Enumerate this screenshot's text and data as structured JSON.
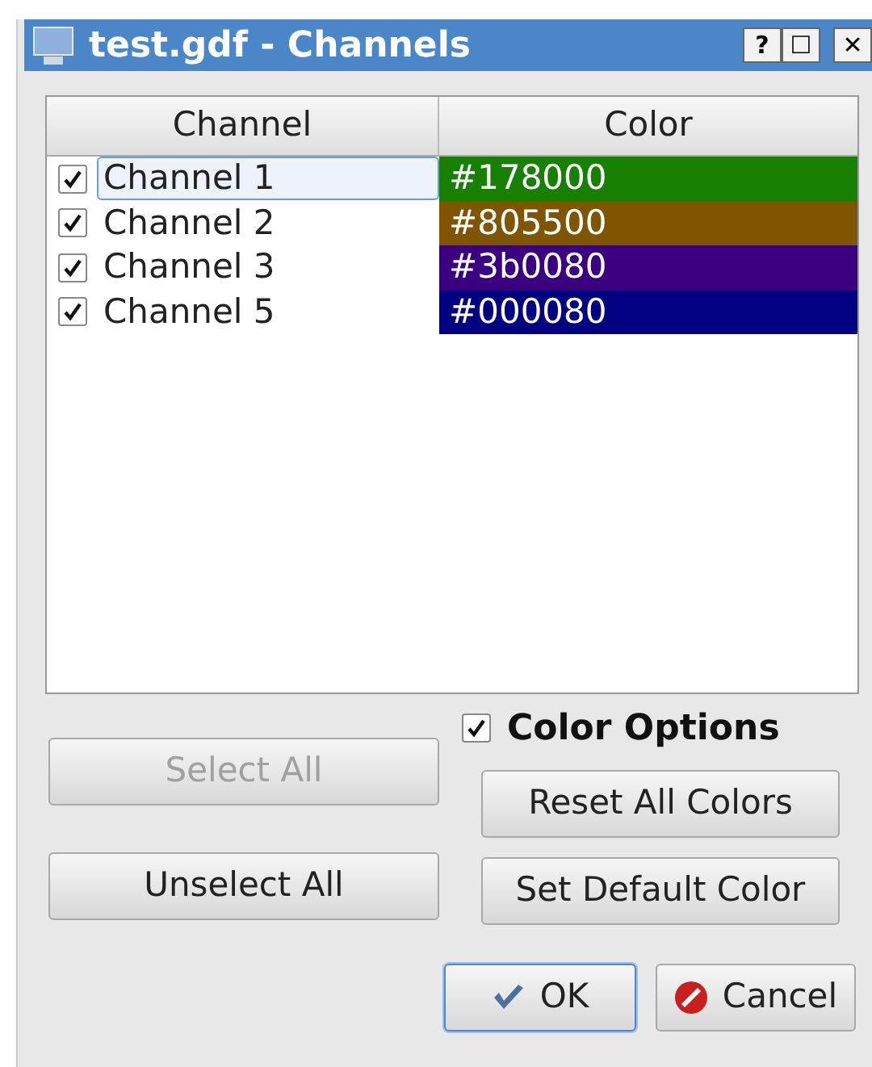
{
  "window": {
    "title": "test.gdf - Channels",
    "controls": [
      "?",
      "☐",
      "✕"
    ]
  },
  "table": {
    "columns": [
      "Channel",
      "Color"
    ],
    "rows": [
      {
        "channel": "Channel 1",
        "checked": true,
        "selected": true,
        "color_label": "#178000",
        "color": "#178000"
      },
      {
        "channel": "Channel 2",
        "checked": true,
        "selected": false,
        "color_label": "#805500",
        "color": "#805500"
      },
      {
        "channel": "Channel 3",
        "checked": true,
        "selected": false,
        "color_label": "#3b0080",
        "color": "#3b0080"
      },
      {
        "channel": "Channel 5",
        "checked": true,
        "selected": false,
        "color_label": "#000080",
        "color": "#000080"
      }
    ]
  },
  "left_buttons": [
    {
      "label": "Select All",
      "disabled": true
    },
    {
      "label": "Unselect All",
      "disabled": false
    }
  ],
  "color_options": {
    "label": "Color Options",
    "checked": true,
    "buttons": [
      "Reset All Colors",
      "Set Default Color"
    ]
  },
  "dialog_buttons": [
    {
      "label": "OK",
      "kind": "ok",
      "focused": true
    },
    {
      "label": "Cancel",
      "kind": "cancel",
      "focused": false
    }
  ]
}
